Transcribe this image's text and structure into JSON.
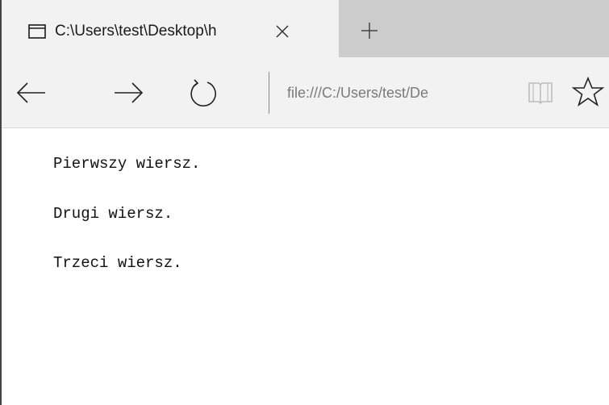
{
  "tab": {
    "title": "C:\\Users\\test\\Desktop\\h",
    "page_icon": "page-icon",
    "close_icon": "close-icon",
    "new_tab_icon": "plus-icon"
  },
  "navbar": {
    "back_icon": "arrow-left-icon",
    "forward_icon": "arrow-right-icon",
    "refresh_icon": "refresh-icon",
    "address": "file:///C:/Users/test/De",
    "reading_view_icon": "book-icon",
    "favorite_icon": "star-icon"
  },
  "content": {
    "lines": [
      "Pierwszy wiersz.",
      "Drugi wiersz.",
      "Trzeci wiersz."
    ]
  },
  "colors": {
    "tab_active": "#f2f2f2",
    "tabstrip": "#cccccc",
    "address_text": "#7a7a7a"
  }
}
